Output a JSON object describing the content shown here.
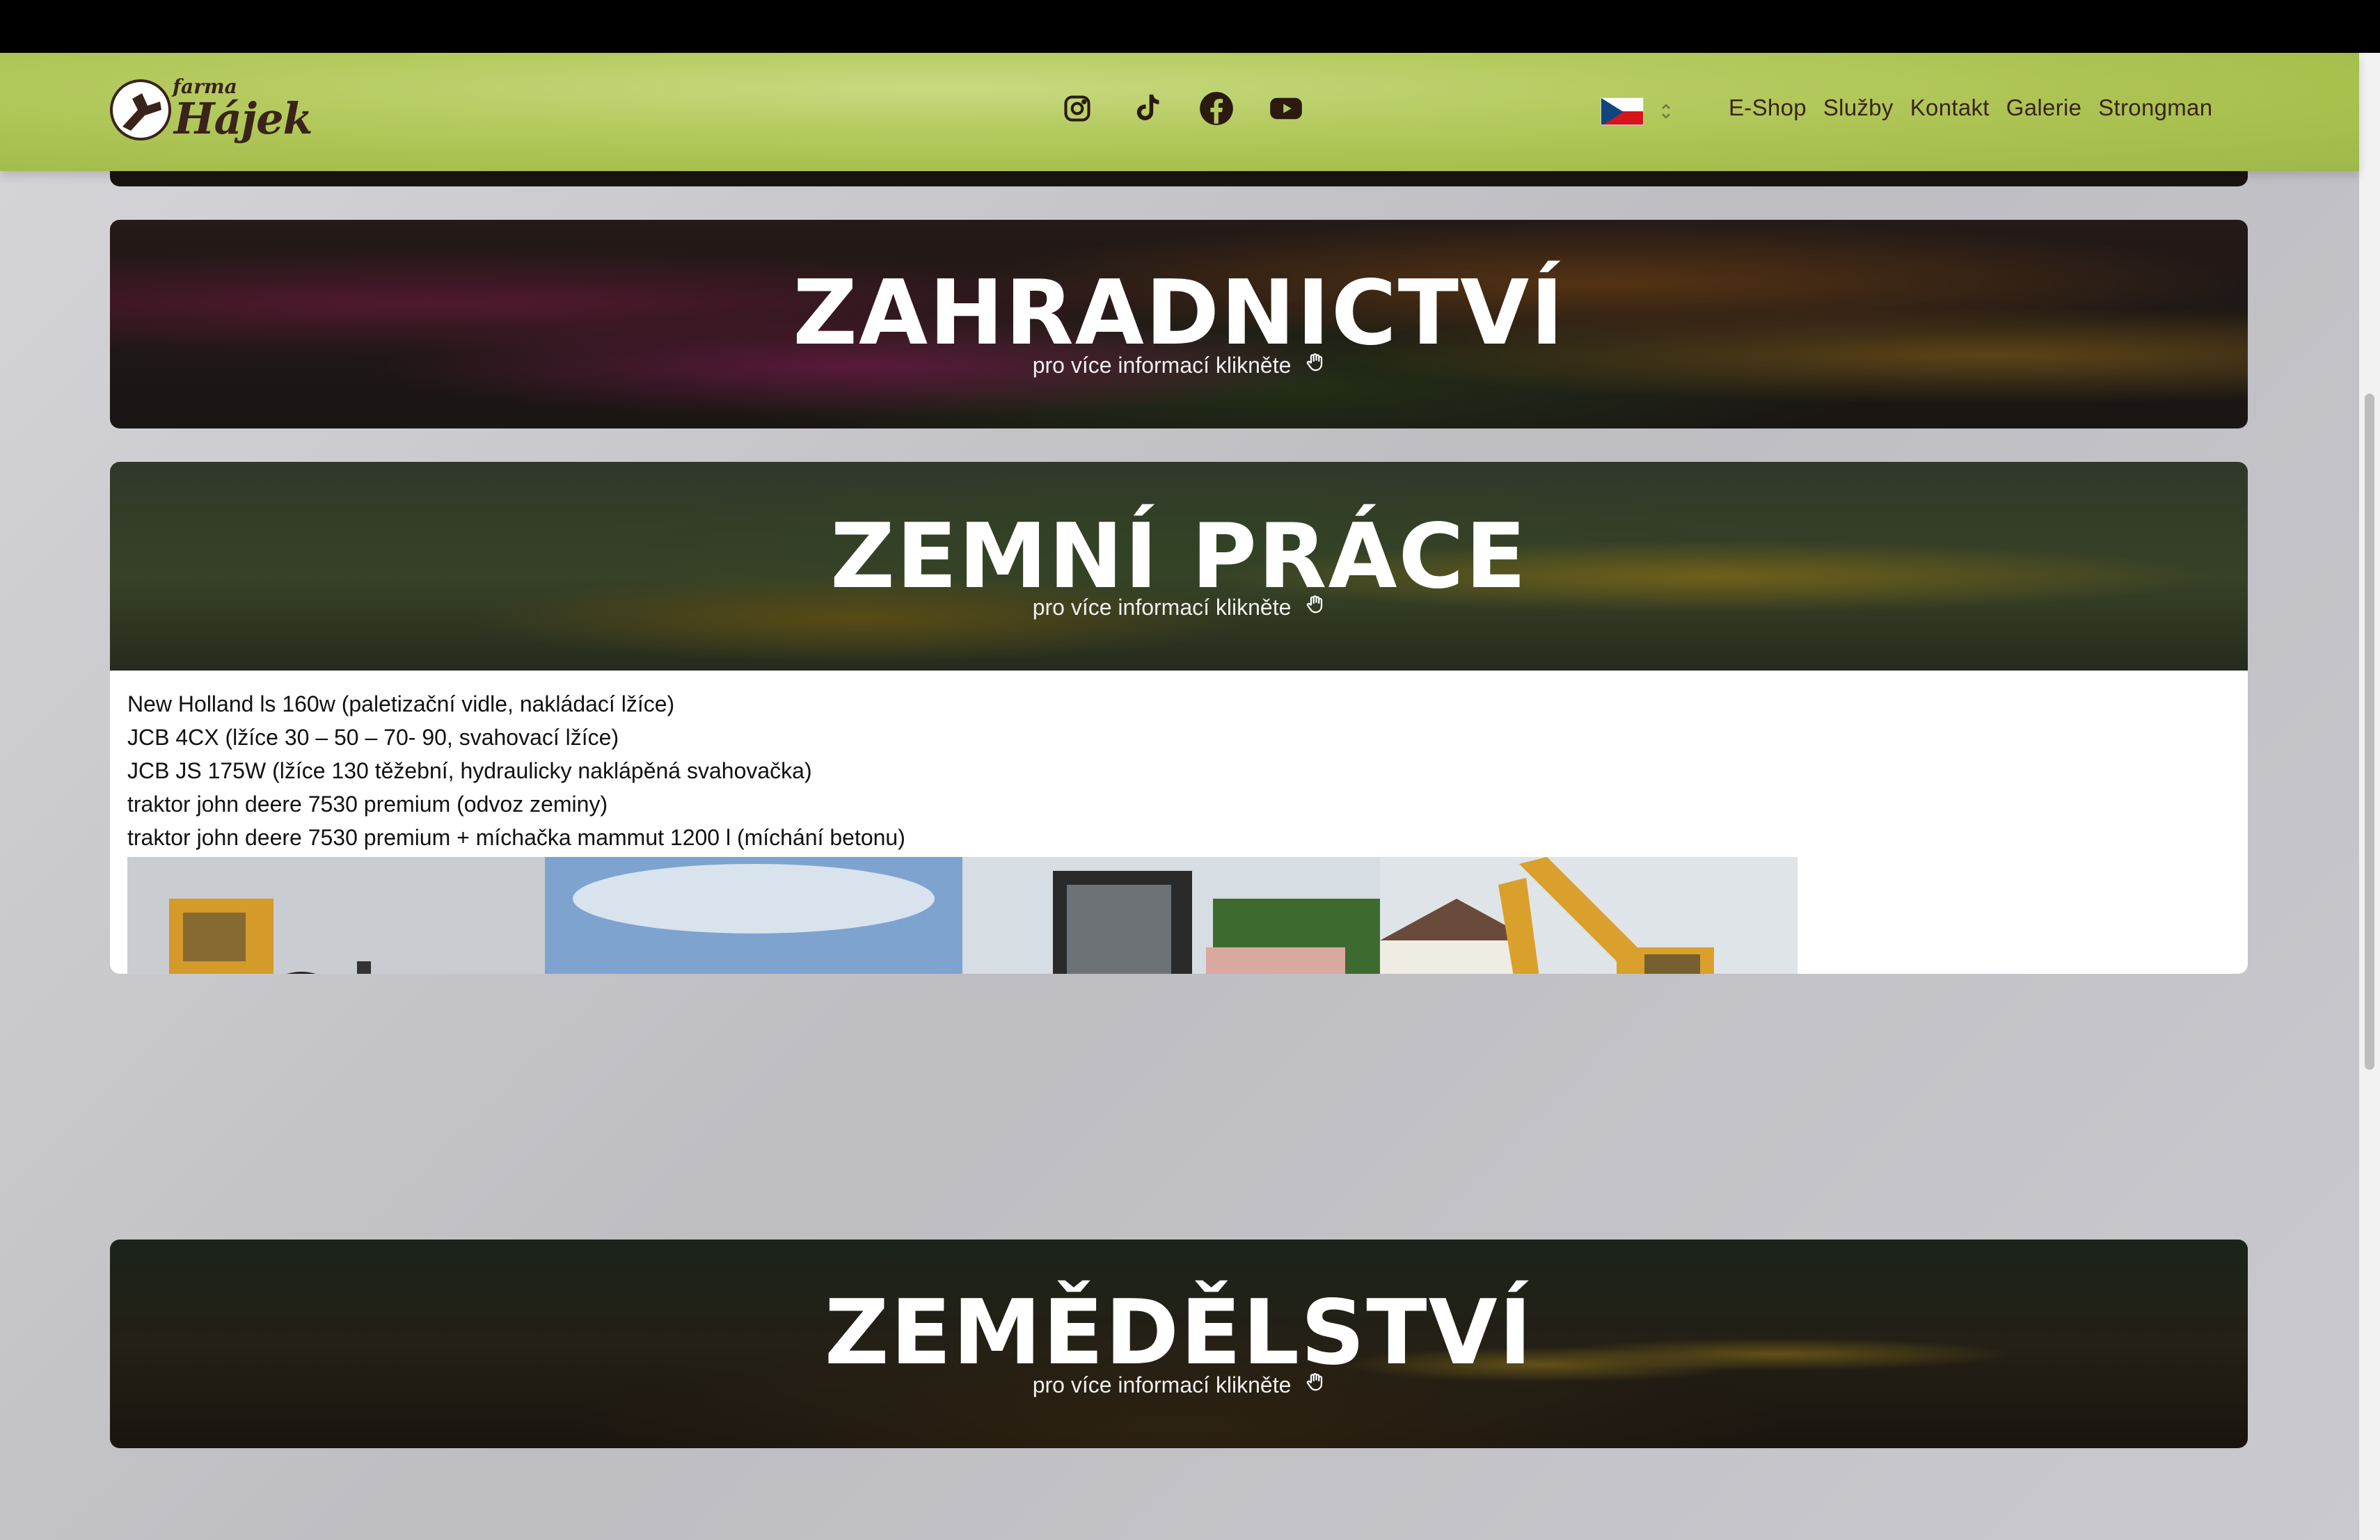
{
  "header": {
    "logo_small": "farma",
    "logo_big": "Hájek",
    "socials": [
      "instagram-icon",
      "tiktok-icon",
      "facebook-icon",
      "youtube-icon"
    ],
    "language": "cs",
    "nav": [
      "E-Shop",
      "Služby",
      "Kontakt",
      "Galerie",
      "Strongman"
    ]
  },
  "services": [
    {
      "title": "ZAHRADNICTVÍ",
      "cta": "pro více informací klikněte"
    },
    {
      "title": "ZEMNÍ PRÁCE",
      "cta": "pro více informací klikněte",
      "lines": [
        "New Holland ls 160w (paletizační vidle, nakládací lžíce)",
        "JCB 4CX (lžíce 30 – 50 – 70- 90, svahovací lžíce)",
        "JCB JS 175W (lžíce 130 těžební, hydraulicky naklápěná svahovačka)",
        "traktor john deere 7530 premium (odvoz zeminy)",
        "traktor john deere 7530 premium + míchačka mammut 1200 l (míchání betonu)"
      ],
      "gallery": [
        "backhoe-loader-photo",
        "john-deere-tractor-photo",
        "new-holland-skid-steer-photo",
        "jcb-excavator-photo"
      ]
    },
    {
      "title": "ZEMĚDĚLSTVÍ",
      "cta": "pro více informací klikněte"
    }
  ],
  "colors": {
    "navbar": "#aec356",
    "brand_brown": "#3a2318"
  }
}
